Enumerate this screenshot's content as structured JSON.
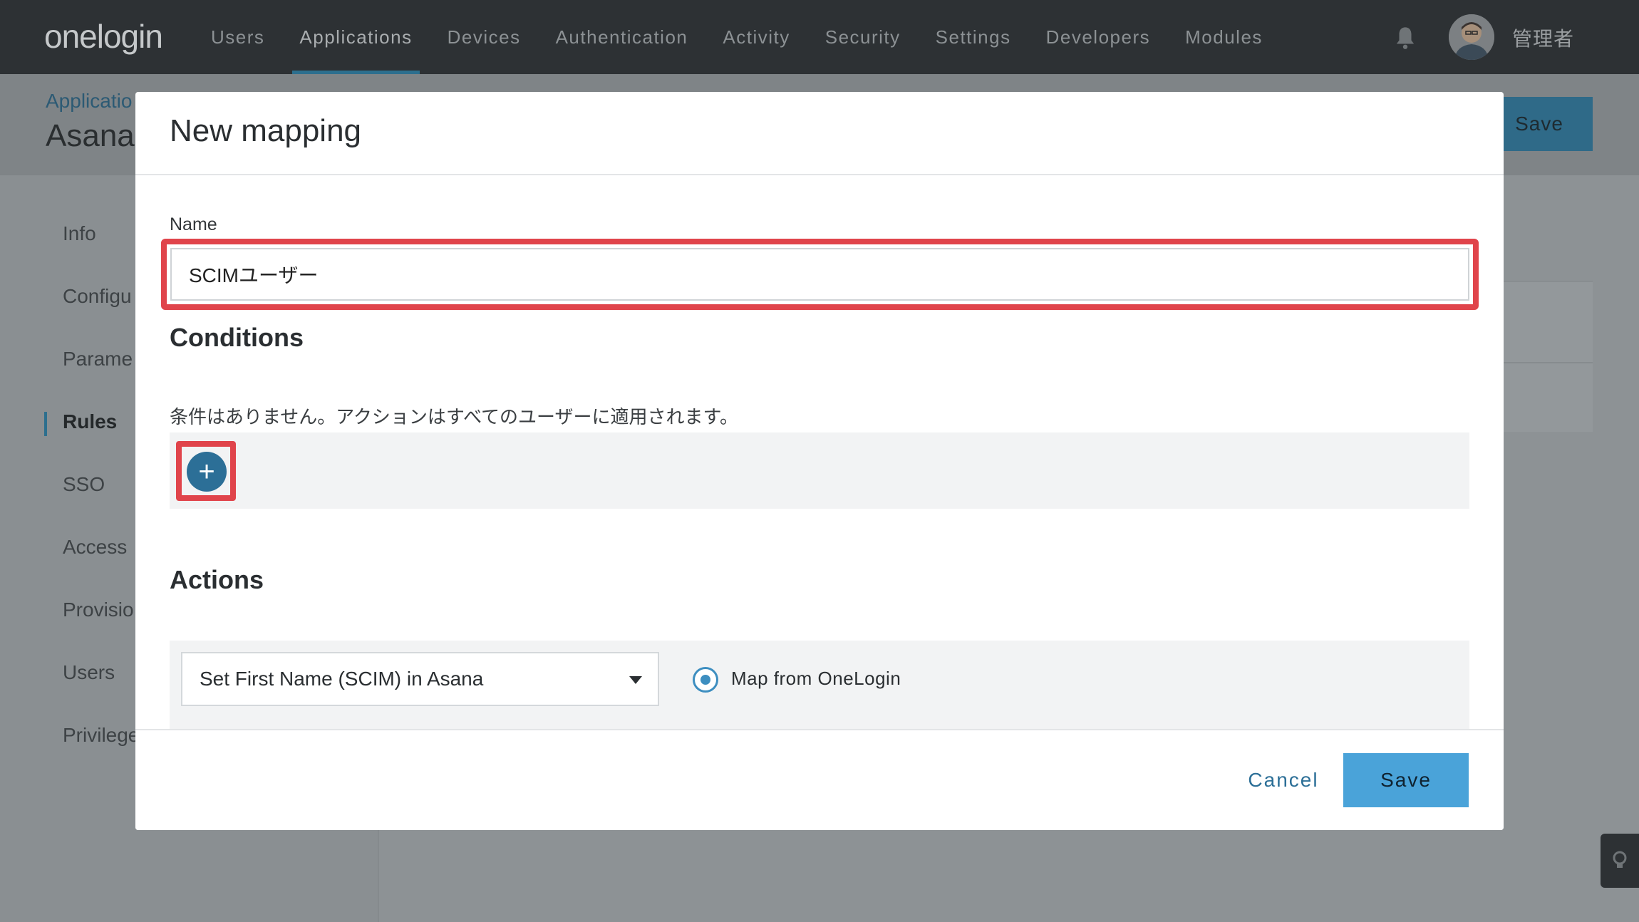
{
  "topnav": {
    "logo": "onelogin",
    "items": [
      "Users",
      "Applications",
      "Devices",
      "Authentication",
      "Activity",
      "Security",
      "Settings",
      "Developers",
      "Modules"
    ],
    "active_item": "Applications",
    "user_name": "管理者"
  },
  "page": {
    "breadcrumb": "Applicatio",
    "app_title": "Asana",
    "save_label": "Save",
    "sidebar": [
      "Info",
      "Configu",
      "Parame",
      "Rules",
      "SSO",
      "Access",
      "Provisio",
      "Users",
      "Privilege"
    ],
    "active_sidebar": "Rules"
  },
  "modal": {
    "title": "New mapping",
    "name_label": "Name",
    "name_value": "SCIMユーザー",
    "conditions_title": "Conditions",
    "conditions_text": "条件はありません。アクションはすべてのユーザーに適用されます。",
    "add_label": "+",
    "actions_title": "Actions",
    "action_selected": "Set First Name (SCIM) in Asana",
    "radio_label": "Map from OneLogin",
    "radio_selected": true,
    "cancel_label": "Cancel",
    "save_label": "Save"
  },
  "colors": {
    "highlight": "#e0444b",
    "primary": "#4aa3d9",
    "accent": "#2c6f97"
  }
}
